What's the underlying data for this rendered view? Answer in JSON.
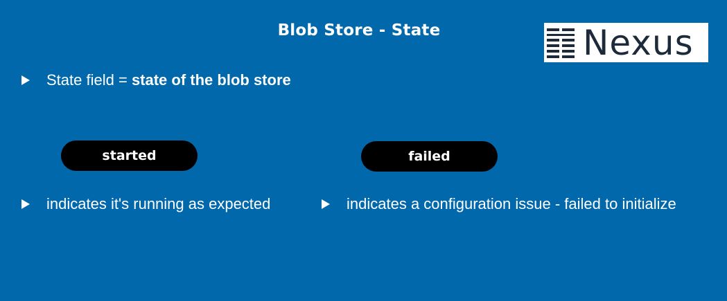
{
  "slide": {
    "title": "Blob Store - State",
    "logo": {
      "text": "Nexus",
      "icon": "nexus-logo-icon"
    },
    "intro": {
      "prefix": "State field = ",
      "emphasis": "state of the blob store"
    },
    "states": [
      {
        "label": "started",
        "description": "indicates it's running as expected"
      },
      {
        "label": "failed",
        "description": "indicates a configuration issue - failed to initialize"
      }
    ]
  },
  "colors": {
    "background": "#0068ab",
    "pill": "#000000",
    "text": "#ffffff",
    "logo_text": "#1c2a3a"
  }
}
